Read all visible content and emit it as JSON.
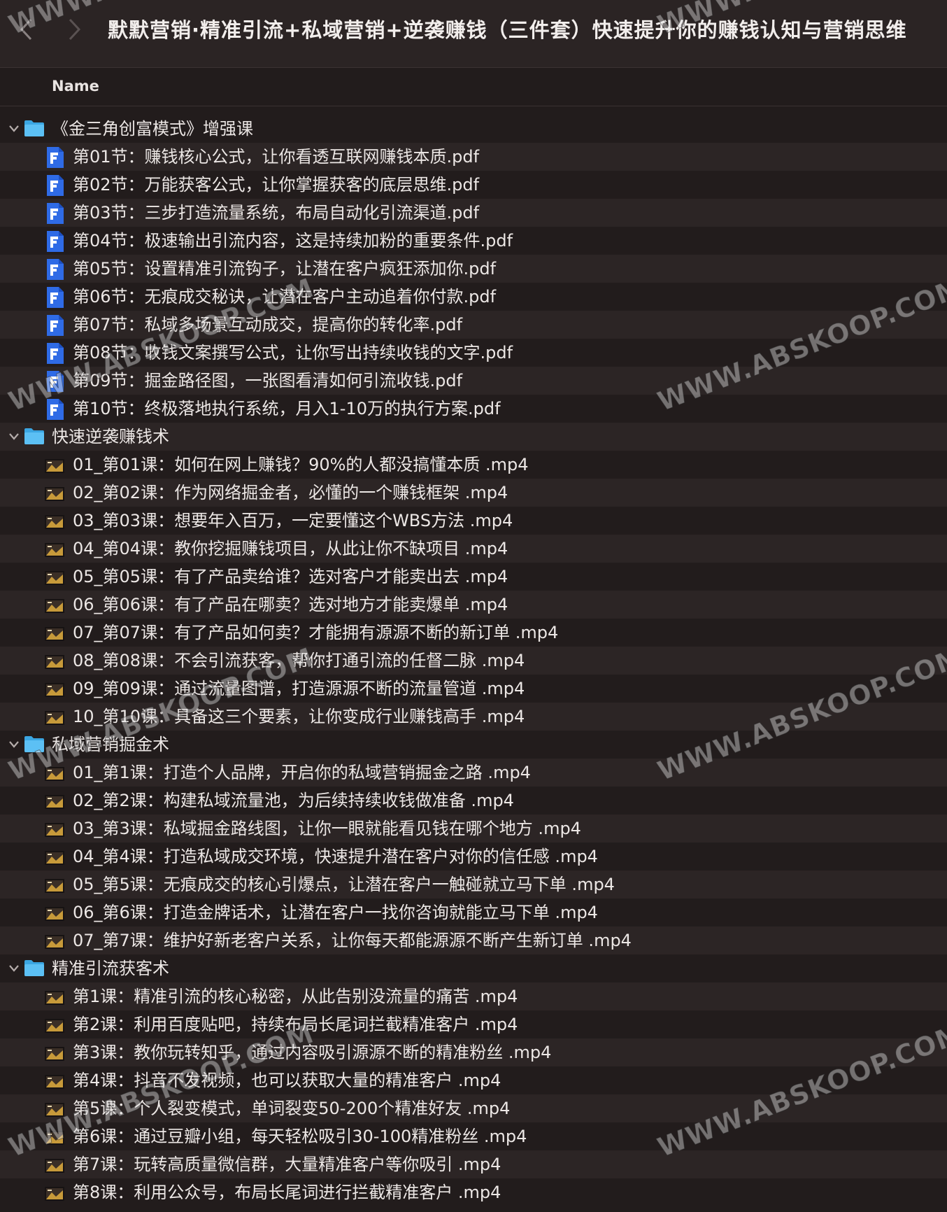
{
  "window": {
    "title": "默默营销·精准引流+私域营销+逆袭赚钱（三件套）快速提升你的赚钱认知与营销思维"
  },
  "column_header": {
    "name": "Name"
  },
  "watermark_text": "WWW.ABSKOOP.COM",
  "folders": [
    {
      "name": "《金三角创富模式》增强课",
      "expanded": true,
      "file_type": "pdf",
      "files": [
        "第01节：赚钱核心公式，让你看透互联网赚钱本质.pdf",
        "第02节：万能获客公式，让你掌握获客的底层思维.pdf",
        "第03节：三步打造流量系统，布局自动化引流渠道.pdf",
        "第04节：极速输出引流内容，这是持续加粉的重要条件.pdf",
        "第05节：设置精准引流钩子，让潜在客户疯狂添加你.pdf",
        "第06节：无痕成交秘诀，让潜在客户主动追着你付款.pdf",
        "第07节：私域多场景互动成交，提高你的转化率.pdf",
        "第08节：收钱文案撰写公式，让你写出持续收钱的文字.pdf",
        "第09节：掘金路径图，一张图看清如何引流收钱.pdf",
        "第10节：终极落地执行系统，月入1-10万的执行方案.pdf"
      ]
    },
    {
      "name": "快速逆袭赚钱术",
      "expanded": true,
      "file_type": "video",
      "files": [
        "01_第01课：如何在网上赚钱？90%的人都没搞懂本质 .mp4",
        "02_第02课：作为网络掘金者，必懂的一个赚钱框架 .mp4",
        "03_第03课：想要年入百万，一定要懂这个WBS方法 .mp4",
        "04_第04课：教你挖掘赚钱项目，从此让你不缺项目 .mp4",
        "05_第05课：有了产品卖给谁？选对客户才能卖出去 .mp4",
        "06_第06课：有了产品在哪卖？选对地方才能卖爆单 .mp4",
        "07_第07课：有了产品如何卖？才能拥有源源不断的新订单 .mp4",
        "08_第08课：不会引流获客，帮你打通引流的任督二脉 .mp4",
        "09_第09课：通过流量图谱，打造源源不断的流量管道 .mp4",
        "10_第10课：具备这三个要素，让你变成行业赚钱高手 .mp4"
      ]
    },
    {
      "name": "私域营销掘金术",
      "expanded": true,
      "file_type": "video",
      "files": [
        "01_第1课：打造个人品牌，开启你的私域营销掘金之路 .mp4",
        "02_第2课：构建私域流量池，为后续持续收钱做准备 .mp4",
        "03_第3课：私域掘金路线图，让你一眼就能看见钱在哪个地方 .mp4",
        "04_第4课：打造私域成交环境，快速提升潜在客户对你的信任感 .mp4",
        "05_第5课：无痕成交的核心引爆点，让潜在客户一触碰就立马下单 .mp4",
        "06_第6课：打造金牌话术，让潜在客户一找你咨询就能立马下单 .mp4",
        "07_第7课：维护好新老客户关系，让你每天都能源源不断产生新订单 .mp4"
      ]
    },
    {
      "name": "精准引流获客术",
      "expanded": true,
      "file_type": "video",
      "files": [
        "第1课：精准引流的核心秘密，从此告别没流量的痛苦 .mp4",
        "第2课：利用百度贴吧，持续布局长尾词拦截精准客户 .mp4",
        "第3课：教你玩转知乎，通过内容吸引源源不断的精准粉丝 .mp4",
        "第4课：抖音不发视频，也可以获取大量的精准客户 .mp4",
        "第5课：个人裂变模式，单词裂变50-200个精准好友 .mp4",
        "第6课：通过豆瓣小组，每天轻松吸引30-100精准粉丝 .mp4",
        "第7课：玩转高质量微信群，大量精准客户等你吸引 .mp4",
        "第8课：利用公众号，布局长尾词进行拦截精准客户 .mp4"
      ]
    }
  ]
}
